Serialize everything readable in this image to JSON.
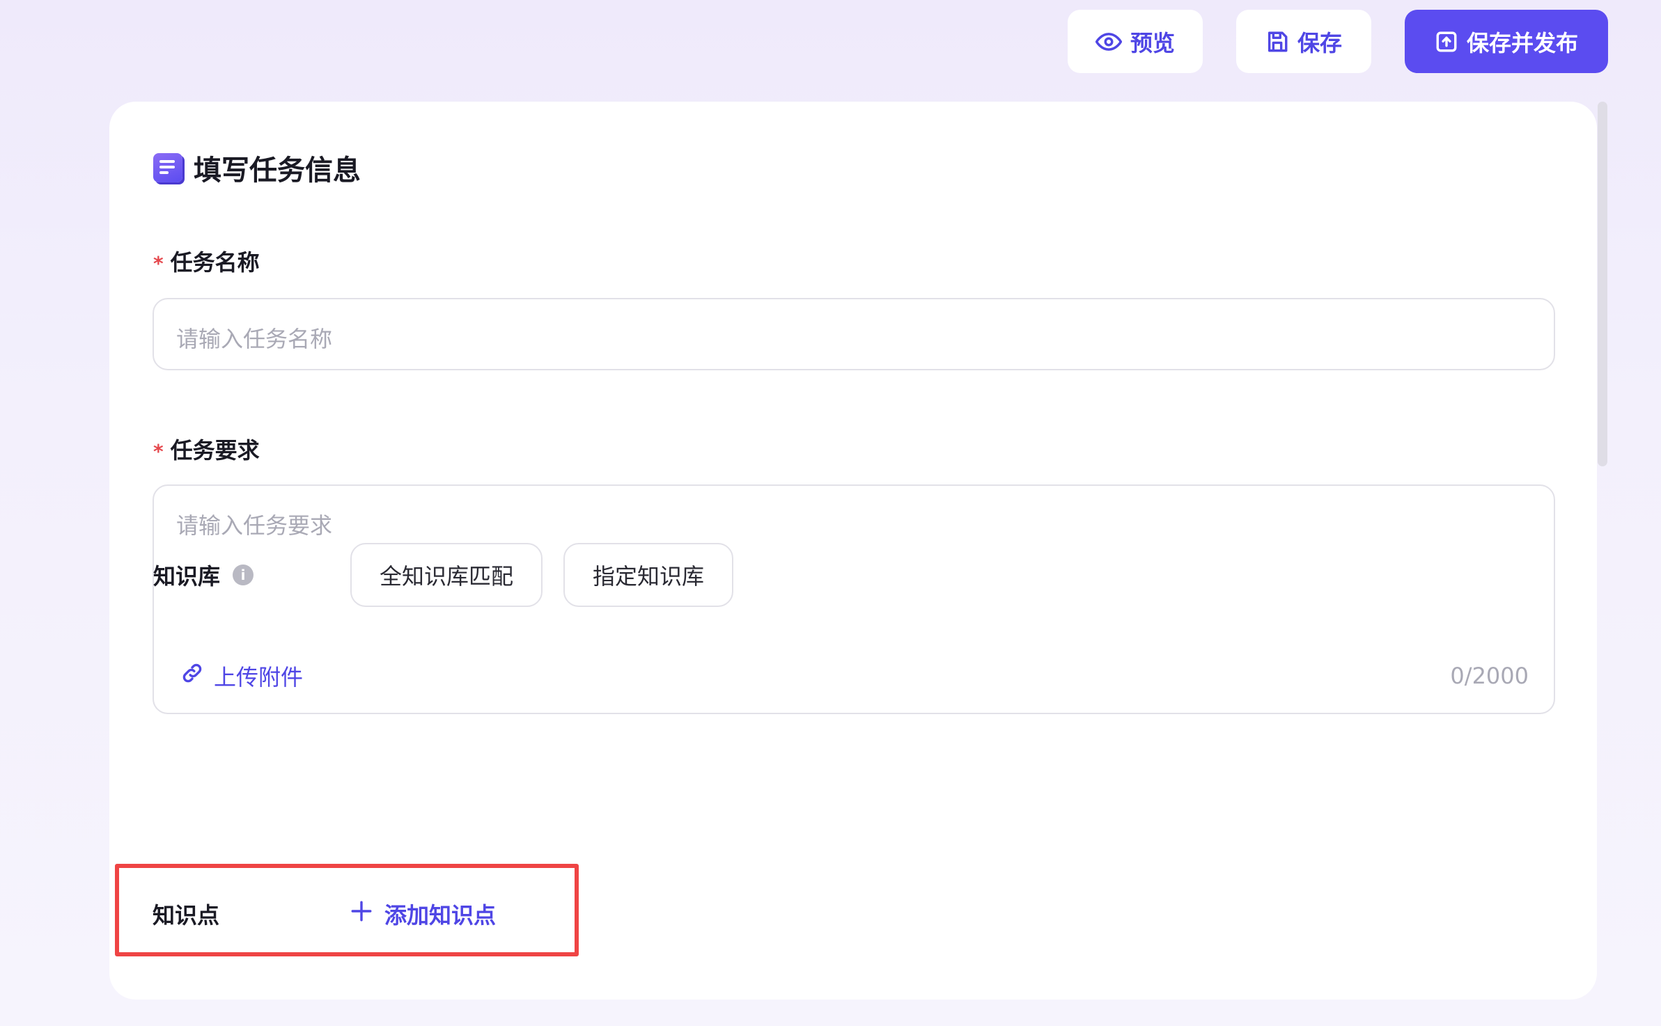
{
  "toolbar": {
    "preview_label": "预览",
    "save_label": "保存",
    "save_publish_label": "保存并发布"
  },
  "form": {
    "title": "填写任务信息",
    "task_name": {
      "required_mark": "*",
      "label": "任务名称",
      "placeholder": "请输入任务名称"
    },
    "task_requirements": {
      "required_mark": "*",
      "label": "任务要求",
      "placeholder": "请输入任务要求",
      "upload_label": "上传附件",
      "counter": "0/2000"
    },
    "knowledge_base": {
      "label": "知识库",
      "info_icon": "i",
      "options": [
        "全知识库匹配",
        "指定知识库"
      ]
    },
    "knowledge_points": {
      "label": "知识点",
      "add_label": "添加知识点"
    }
  },
  "colors": {
    "accent": "#4f46e5",
    "primary_button": "#5b4cf0",
    "required": "#e5484d",
    "highlight_border": "#ef4444"
  },
  "icons": {
    "preview": "eye-icon",
    "save": "floppy-disk-icon",
    "save_publish": "upload-box-icon",
    "title": "document-icon",
    "upload": "paperclip-link-icon",
    "info": "info-icon",
    "add": "plus-icon"
  }
}
